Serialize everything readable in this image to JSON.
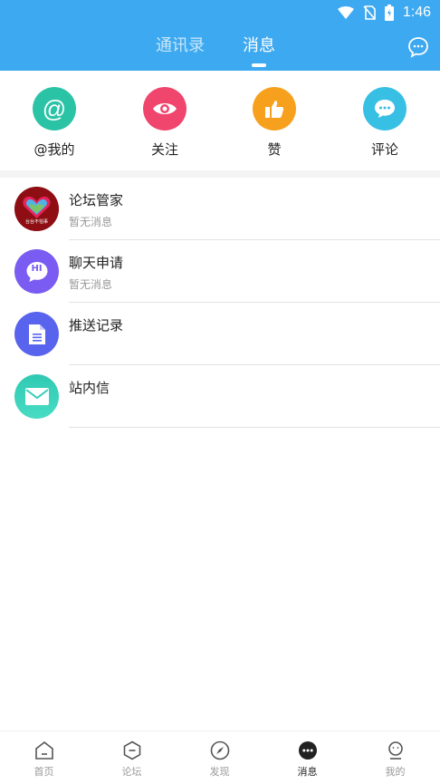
{
  "status_bar": {
    "time": "1:46"
  },
  "header": {
    "tabs": [
      {
        "label": "通讯录"
      },
      {
        "label": "消息"
      }
    ],
    "active_tab": "消息",
    "color": "#3da9f0"
  },
  "quick_actions": [
    {
      "label": "@我的",
      "icon": "at-icon",
      "color": "#2bc3a6"
    },
    {
      "label": "关注",
      "icon": "eye-icon",
      "color": "#f0456c"
    },
    {
      "label": "赞",
      "icon": "thumbs-up-icon",
      "color": "#f7a01d"
    },
    {
      "label": "评论",
      "icon": "comment-icon",
      "color": "#38bfe4"
    }
  ],
  "messages": [
    {
      "title": "论坛管家",
      "subtitle": "暂无消息",
      "avatar_caption": "台台不怕事"
    },
    {
      "title": "聊天申请",
      "subtitle": "暂无消息",
      "avatar_text": "HI"
    },
    {
      "title": "推送记录",
      "subtitle": ""
    },
    {
      "title": "站内信",
      "subtitle": ""
    }
  ],
  "bottom_nav": [
    {
      "label": "首页",
      "icon": "home-icon"
    },
    {
      "label": "论坛",
      "icon": "forum-icon"
    },
    {
      "label": "发现",
      "icon": "compass-icon"
    },
    {
      "label": "消息",
      "icon": "message-icon",
      "active": true
    },
    {
      "label": "我的",
      "icon": "profile-icon"
    }
  ]
}
